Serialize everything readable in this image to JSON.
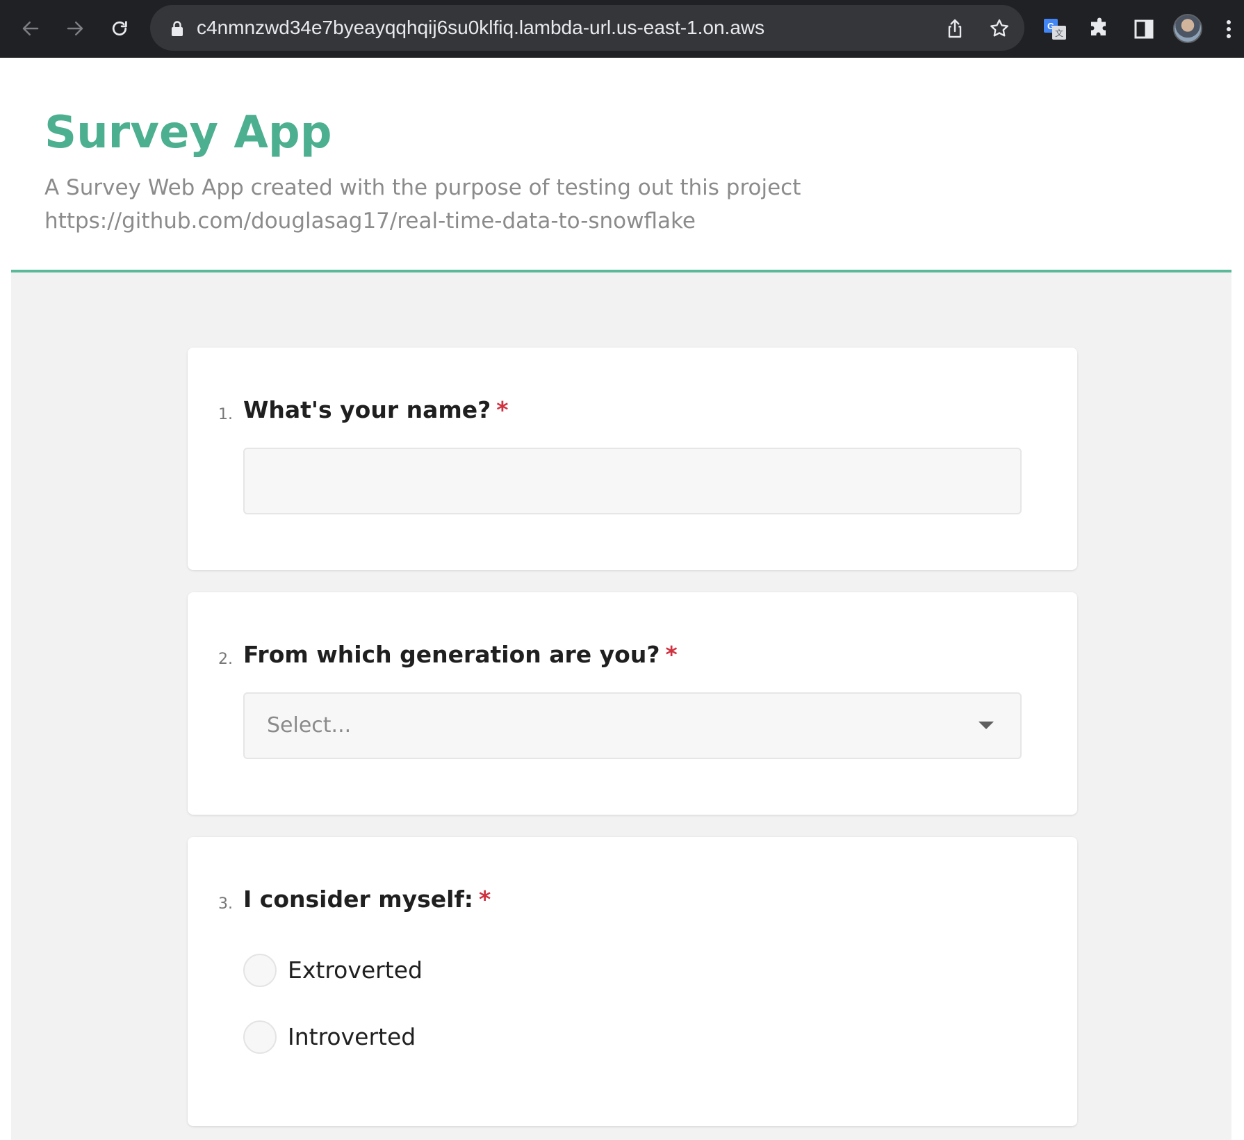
{
  "browser": {
    "url": "c4nmnzwd34e7byeayqqhqij6su0klfiq.lambda-url.us-east-1.on.aws"
  },
  "header": {
    "title": "Survey App",
    "description": "A Survey Web App created with the purpose of testing out this project https://github.com/douglasag17/real-time-data-to-snowflake"
  },
  "questions": [
    {
      "number": "1.",
      "text": "What's your name?",
      "required_mark": "*",
      "type": "text",
      "value": ""
    },
    {
      "number": "2.",
      "text": "From which generation are you?",
      "required_mark": "*",
      "type": "select",
      "placeholder": "Select..."
    },
    {
      "number": "3.",
      "text": "I consider myself:",
      "required_mark": "*",
      "type": "radio",
      "options": [
        "Extroverted",
        "Introverted"
      ]
    }
  ],
  "colors": {
    "accent": "#4caf8f",
    "required": "#d0313f",
    "description": "#8b8b8b",
    "background": "#f2f2f2"
  }
}
